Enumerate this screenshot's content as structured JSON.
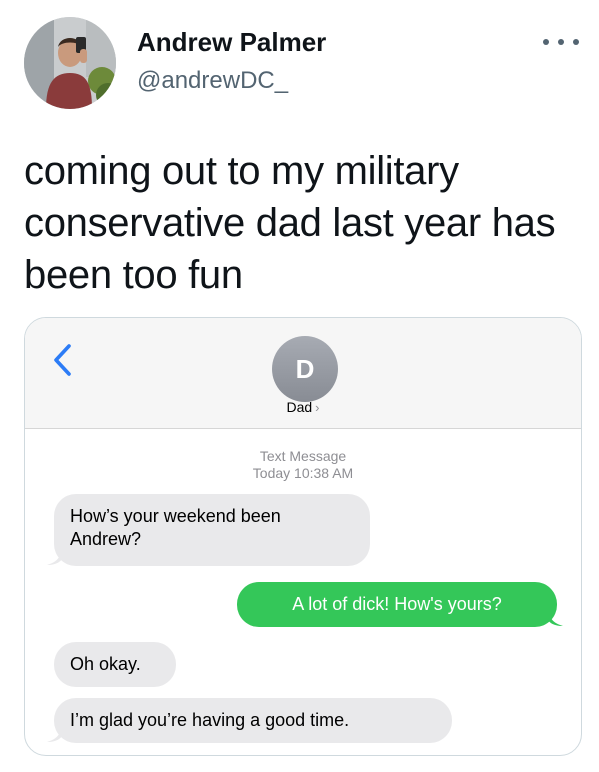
{
  "tweet": {
    "author": {
      "name": "Andrew Palmer",
      "handle": "@andrewDC_"
    },
    "text": "coming out to my military conservative dad last year has been too fun"
  },
  "screenshot": {
    "contact": {
      "initial": "D",
      "name": "Dad",
      "chevron": "›"
    },
    "meta": {
      "type": "Text Message",
      "time": "Today 10:38 AM"
    },
    "messages": [
      {
        "direction": "incoming",
        "text": "How’s your weekend been Andrew?"
      },
      {
        "direction": "outgoing",
        "text": "A lot of dick! How's yours?"
      },
      {
        "direction": "incoming",
        "text": "Oh okay."
      },
      {
        "direction": "incoming",
        "text": "I’m glad you’re having a good time."
      }
    ]
  },
  "colors": {
    "text_primary": "#0f1419",
    "text_secondary": "#536471",
    "ios_blue": "#2c7cf6",
    "bubble_incoming": "#e9e9eb",
    "bubble_outgoing": "#34c759",
    "meta_gray": "#8e8e93"
  },
  "icons": {
    "more": "more-horizontal-icon",
    "back": "chevron-left-icon"
  }
}
